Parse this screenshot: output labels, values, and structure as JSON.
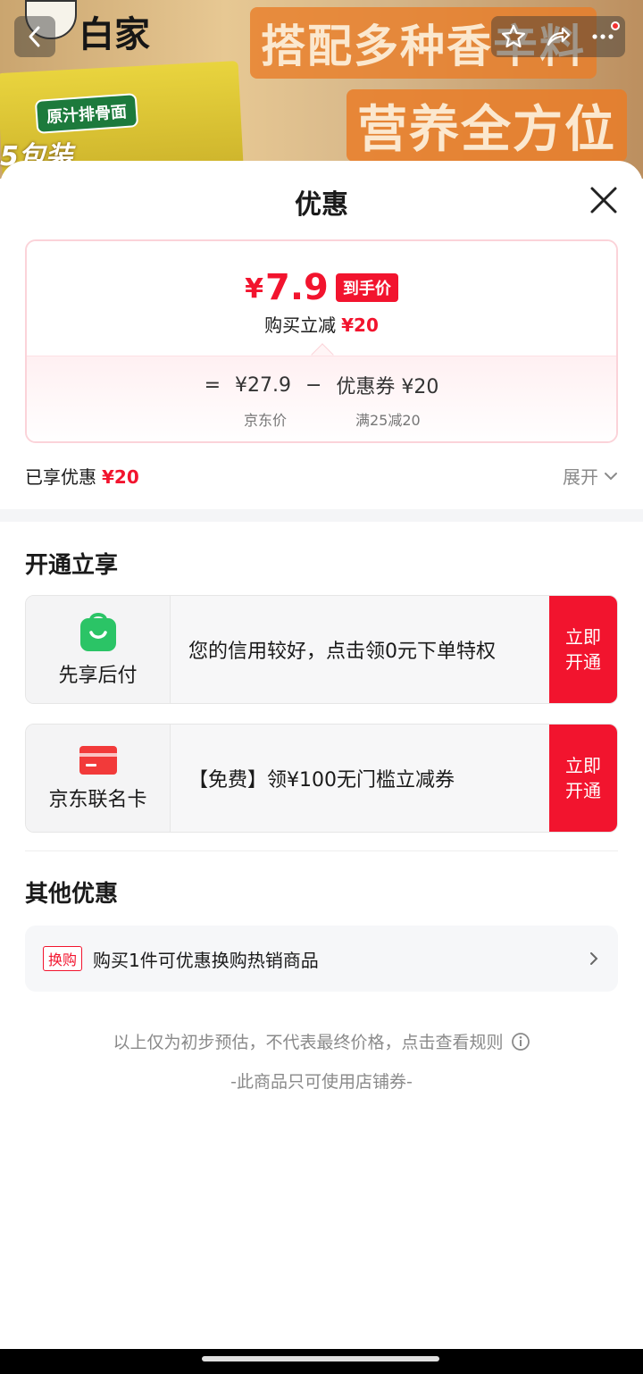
{
  "banner": {
    "brand": "白家",
    "package_tag": "原汁排骨面",
    "package_text": "5包装",
    "slogan_line1": "搭配多种香辛料",
    "slogan_line2": "营养全方位"
  },
  "sheet": {
    "title": "优惠"
  },
  "price": {
    "yen": "¥",
    "final": "7.9",
    "tag": "到手价",
    "sub_label": "购买立减",
    "sub_amount": "¥20",
    "eq": "=",
    "jd_price": "¥27.9",
    "minus": "−",
    "coupon": "优惠券 ¥20",
    "jd_price_label": "京东价",
    "coupon_rule": "满25减20"
  },
  "enjoyed": {
    "label": "已享优惠",
    "amount": "¥20",
    "expand": "展开"
  },
  "open_section": {
    "title": "开通立享",
    "cards": [
      {
        "name": "先享后付",
        "desc": "您的信用较好，点击领0元下单特权",
        "button": "立即开通",
        "icon_color": "#2bc466"
      },
      {
        "name": "京东联名卡",
        "desc": "【免费】领¥100无门槛立减券",
        "button": "立即开通",
        "icon_color": "#f23a3a"
      }
    ]
  },
  "other_section": {
    "title": "其他优惠",
    "tag": "换购",
    "text": "购买1件可优惠换购热销商品"
  },
  "footer": {
    "note": "以上仅为初步预估，不代表最终价格，点击查看规则",
    "note2": "-此商品只可使用店铺券-"
  },
  "colors": {
    "accent_red": "#f2142e"
  }
}
